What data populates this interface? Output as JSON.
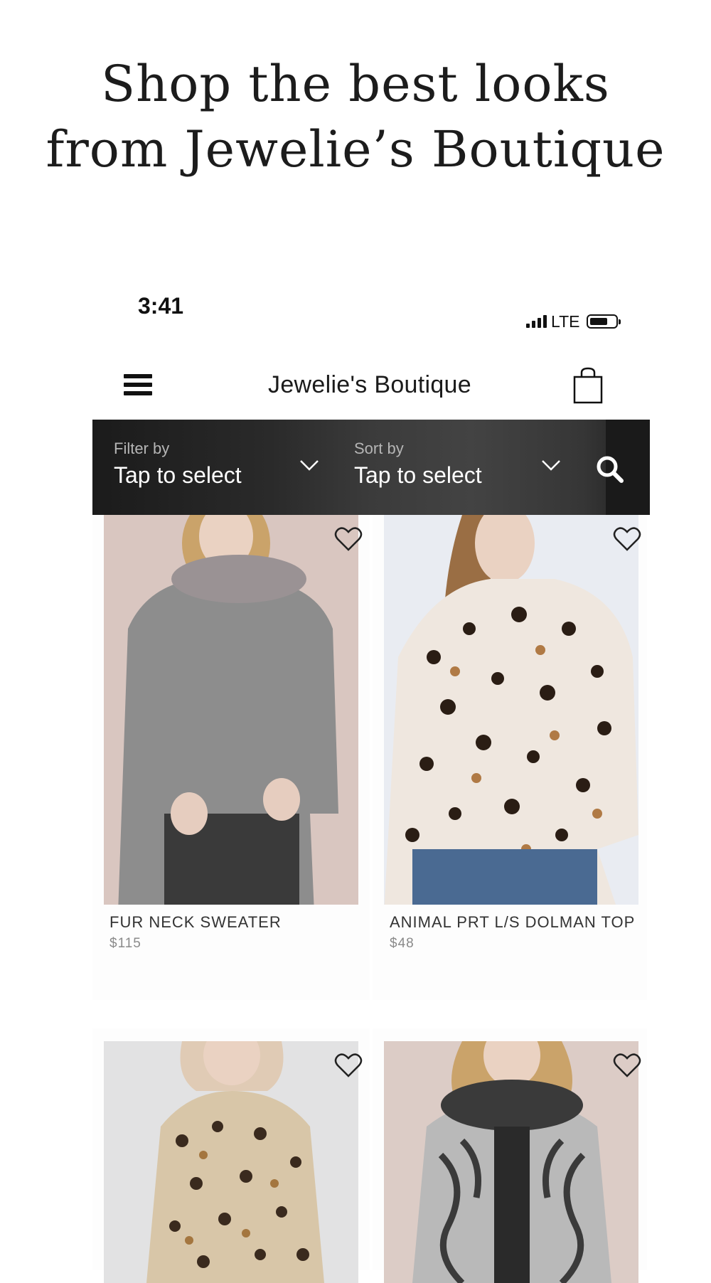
{
  "promo": {
    "line1": "Shop the best looks",
    "line2": "from Jewelie’s Boutique"
  },
  "status_bar": {
    "time": "3:41",
    "carrier": "LTE"
  },
  "header": {
    "title": "Jewelie's Boutique"
  },
  "filter_bar": {
    "filter_label": "Filter by",
    "filter_value": "Tap to select",
    "sort_label": "Sort by",
    "sort_value": "Tap to select"
  },
  "products": [
    {
      "name": "FUR NECK SWEATER",
      "price": "$115"
    },
    {
      "name": "ANIMAL PRT L/S DOLMAN TOP",
      "price": "$48"
    },
    {
      "name": "",
      "price": ""
    },
    {
      "name": "",
      "price": ""
    }
  ],
  "colors": {
    "filter_bar_dark": "#1b1b1b",
    "filter_bar_mid": "#434343",
    "text_dark": "#1a1a1a",
    "price_gray": "#8a8a8a"
  }
}
